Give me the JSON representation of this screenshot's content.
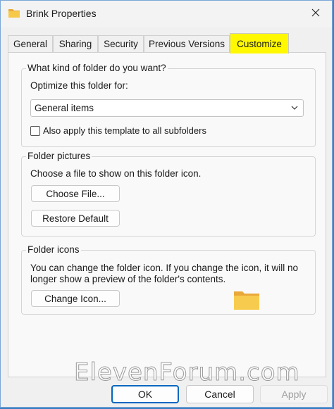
{
  "window": {
    "title": "Brink Properties"
  },
  "tabs": [
    {
      "label": "General"
    },
    {
      "label": "Sharing"
    },
    {
      "label": "Security"
    },
    {
      "label": "Previous Versions"
    },
    {
      "label": "Customize",
      "active": true
    }
  ],
  "kind_group": {
    "title": "What kind of folder do you want?",
    "optimize_label": "Optimize this folder for:",
    "optimize_value": "General items",
    "apply_subfolders_label": "Also apply this template to all subfolders",
    "apply_subfolders_checked": false
  },
  "pictures_group": {
    "title": "Folder pictures",
    "description": "Choose a file to show on this folder icon.",
    "choose_file_label": "Choose File...",
    "restore_default_label": "Restore Default"
  },
  "icons_group": {
    "title": "Folder icons",
    "description_line1": "You can change the folder icon. If you change the icon, it will no",
    "description_line2": "longer show a preview of the folder's contents.",
    "change_icon_label": "Change Icon..."
  },
  "footer": {
    "ok_label": "OK",
    "cancel_label": "Cancel",
    "apply_label": "Apply"
  },
  "watermark": "ElevenForum.com",
  "colors": {
    "active_tab": "#fff800",
    "accent": "#0067c0",
    "folder": "#f5c842"
  },
  "icons": {
    "title": "folder-icon",
    "close": "close-icon",
    "dropdown": "chevron-down-icon"
  }
}
